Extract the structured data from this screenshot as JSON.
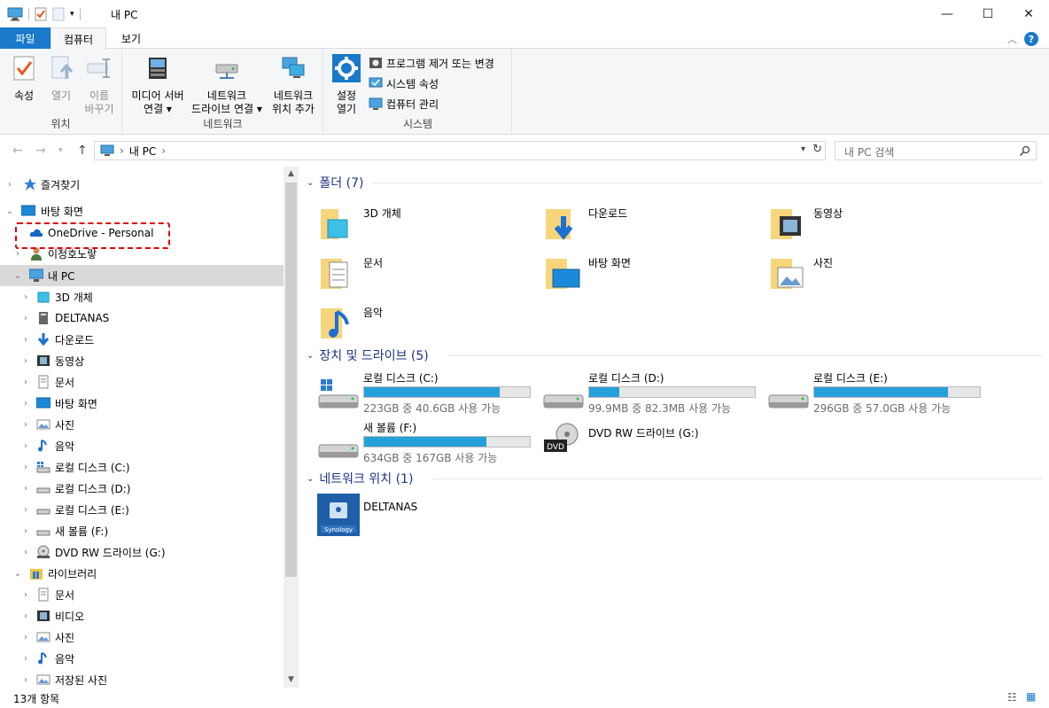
{
  "window": {
    "title": "내 PC",
    "minimize": "—",
    "maximize": "☐",
    "close": "✕"
  },
  "tabs": {
    "file": "파일",
    "computer": "컴퓨터",
    "view": "보기"
  },
  "ribbon": {
    "location": {
      "label": "위치",
      "properties": "속성",
      "open": "열기",
      "rename_1": "이름",
      "rename_2": "바꾸기"
    },
    "network": {
      "label": "네트워크",
      "media_1": "미디어 서버",
      "media_2": "연결 ▾",
      "map_1": "네트워크",
      "map_2": "드라이브 연결 ▾",
      "add_1": "네트워크",
      "add_2": "위치 추가"
    },
    "system": {
      "label": "시스템",
      "settings_1": "설정",
      "settings_2": "열기",
      "uninstall": "프로그램 제거 또는 변경",
      "sysprops": "시스템 속성",
      "manage": "컴퓨터 관리"
    }
  },
  "address": {
    "crumb": "내 PC",
    "search_placeholder": "내 PC 검색"
  },
  "nav": {
    "favorites": "즐겨찾기",
    "desktop": "바탕 화면",
    "onedrive": "OneDrive - Personal",
    "user": "이정호노랗",
    "thispc": "내 PC",
    "pc_children": [
      "3D 개체",
      "DELTANAS",
      "다운로드",
      "동영상",
      "문서",
      "바탕 화면",
      "사진",
      "음악",
      "로컬 디스크 (C:)",
      "로컬 디스크 (D:)",
      "로컬 디스크 (E:)",
      "새 볼륨 (F:)",
      "DVD RW 드라이브 (G:)"
    ],
    "libraries": "라이브러리",
    "lib_children": [
      "문서",
      "비디오",
      "사진",
      "음악",
      "저장된 사진"
    ]
  },
  "sections": {
    "folders": "폴더 (7)",
    "drives": "장치 및 드라이브 (5)",
    "network": "네트워크 위치 (1)"
  },
  "folders": [
    {
      "name": "3D 개체",
      "icon": "3d-objects-icon"
    },
    {
      "name": "다운로드",
      "icon": "downloads-icon"
    },
    {
      "name": "동영상",
      "icon": "videos-icon"
    },
    {
      "name": "문서",
      "icon": "documents-icon"
    },
    {
      "name": "바탕 화면",
      "icon": "desktop-icon"
    },
    {
      "name": "사진",
      "icon": "pictures-icon"
    },
    {
      "name": "음악",
      "icon": "music-icon"
    }
  ],
  "drives": [
    {
      "name": "로컬 디스크 (C:)",
      "info": "223GB 중 40.6GB 사용 가능",
      "used_fraction": 0.82
    },
    {
      "name": "로컬 디스크 (D:)",
      "info": "99.9MB 중 82.3MB 사용 가능",
      "used_fraction": 0.18
    },
    {
      "name": "로컬 디스크 (E:)",
      "info": "296GB 중 57.0GB 사용 가능",
      "used_fraction": 0.81
    },
    {
      "name": "새 볼륨 (F:)",
      "info": "634GB 중 167GB 사용 가능",
      "used_fraction": 0.74
    },
    {
      "name": "DVD RW 드라이브 (G:)",
      "info": "",
      "used_fraction": null
    }
  ],
  "network_locations": [
    {
      "name": "DELTANAS",
      "logo_text": "Synology"
    }
  ],
  "status": {
    "count": "13개 항목"
  },
  "colors": {
    "accent": "#1979ca",
    "bar": "#26a0da",
    "section": "#1e3287",
    "highlight": "#e00000"
  }
}
